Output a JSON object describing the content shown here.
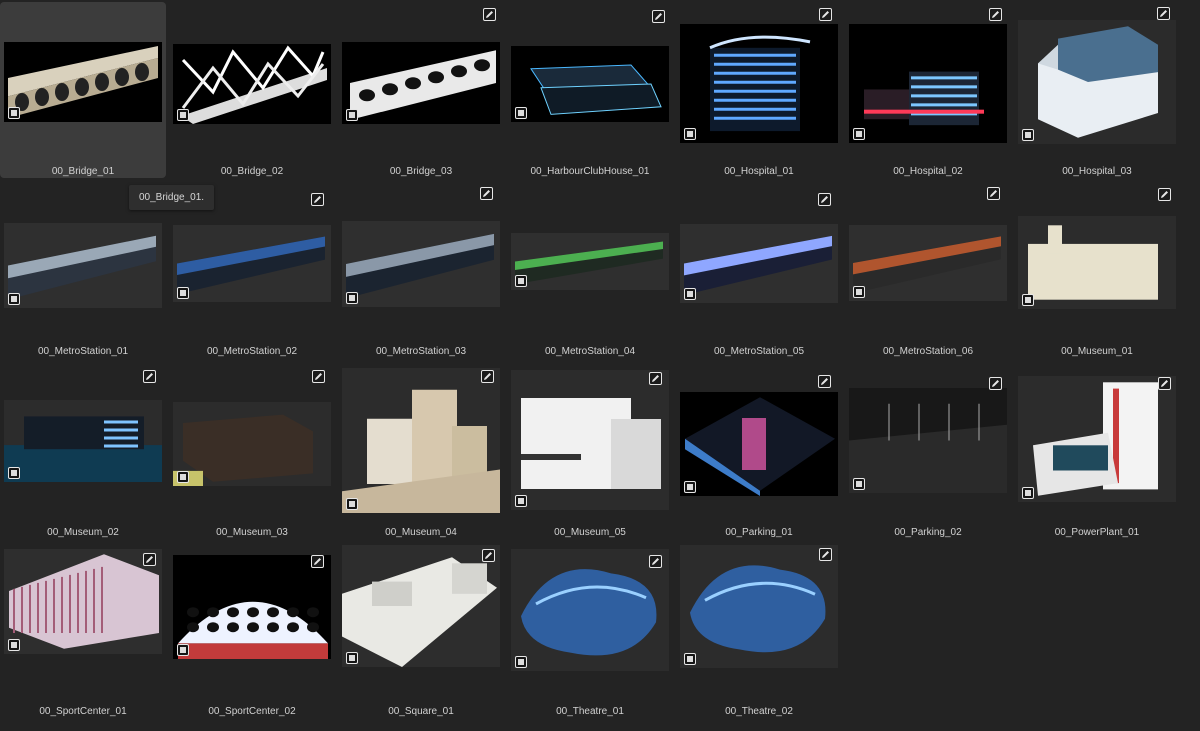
{
  "assets": [
    {
      "label": "00_Bridge_01",
      "icon": "bridge-arches-thumbnail"
    },
    {
      "label": "00_Bridge_02",
      "icon": "bridge-truss-thumbnail"
    },
    {
      "label": "00_Bridge_03",
      "icon": "bridge-perforated-thumbnail"
    },
    {
      "label": "00_HarbourClubHouse_01",
      "icon": "clubhouse-thumbnail"
    },
    {
      "label": "00_Hospital_01",
      "icon": "hospital-night-thumbnail"
    },
    {
      "label": "00_Hospital_02",
      "icon": "hospital-neon-thumbnail"
    },
    {
      "label": "00_Hospital_03",
      "icon": "hospital-white-thumbnail"
    },
    {
      "label": "00_MetroStation_01",
      "icon": "metro-station-thumbnail"
    },
    {
      "label": "00_MetroStation_02",
      "icon": "metro-station-thumbnail"
    },
    {
      "label": "00_MetroStation_03",
      "icon": "metro-station-thumbnail"
    },
    {
      "label": "00_MetroStation_04",
      "icon": "metro-station-thumbnail"
    },
    {
      "label": "00_MetroStation_05",
      "icon": "metro-station-thumbnail"
    },
    {
      "label": "00_MetroStation_06",
      "icon": "metro-station-thumbnail"
    },
    {
      "label": "00_Museum_01",
      "icon": "museum-thumbnail"
    },
    {
      "label": "00_Museum_02",
      "icon": "museum-thumbnail"
    },
    {
      "label": "00_Museum_03",
      "icon": "museum-thumbnail"
    },
    {
      "label": "00_Museum_04",
      "icon": "museum-thumbnail"
    },
    {
      "label": "00_Museum_05",
      "icon": "museum-thumbnail"
    },
    {
      "label": "00_Parking_01",
      "icon": "parking-thumbnail"
    },
    {
      "label": "00_Parking_02",
      "icon": "parking-lot-thumbnail"
    },
    {
      "label": "00_PowerPlant_01",
      "icon": "power-plant-thumbnail"
    },
    {
      "label": "00_SportCenter_01",
      "icon": "sport-center-thumbnail"
    },
    {
      "label": "00_SportCenter_02",
      "icon": "sport-center-dome-thumbnail"
    },
    {
      "label": "00_Square_01",
      "icon": "square-thumbnail"
    },
    {
      "label": "00_Theatre_01",
      "icon": "theatre-thumbnail"
    },
    {
      "label": "00_Theatre_02",
      "icon": "theatre-thumbnail"
    }
  ],
  "tooltip": {
    "text": "00_Bridge_01."
  },
  "icons": {
    "edit": "edit-pencil-icon",
    "select": "select-checkbox-icon"
  },
  "colors": {
    "background": "#232323",
    "selected_tile": "#3c3c3c",
    "label": "#d2d2d2"
  }
}
